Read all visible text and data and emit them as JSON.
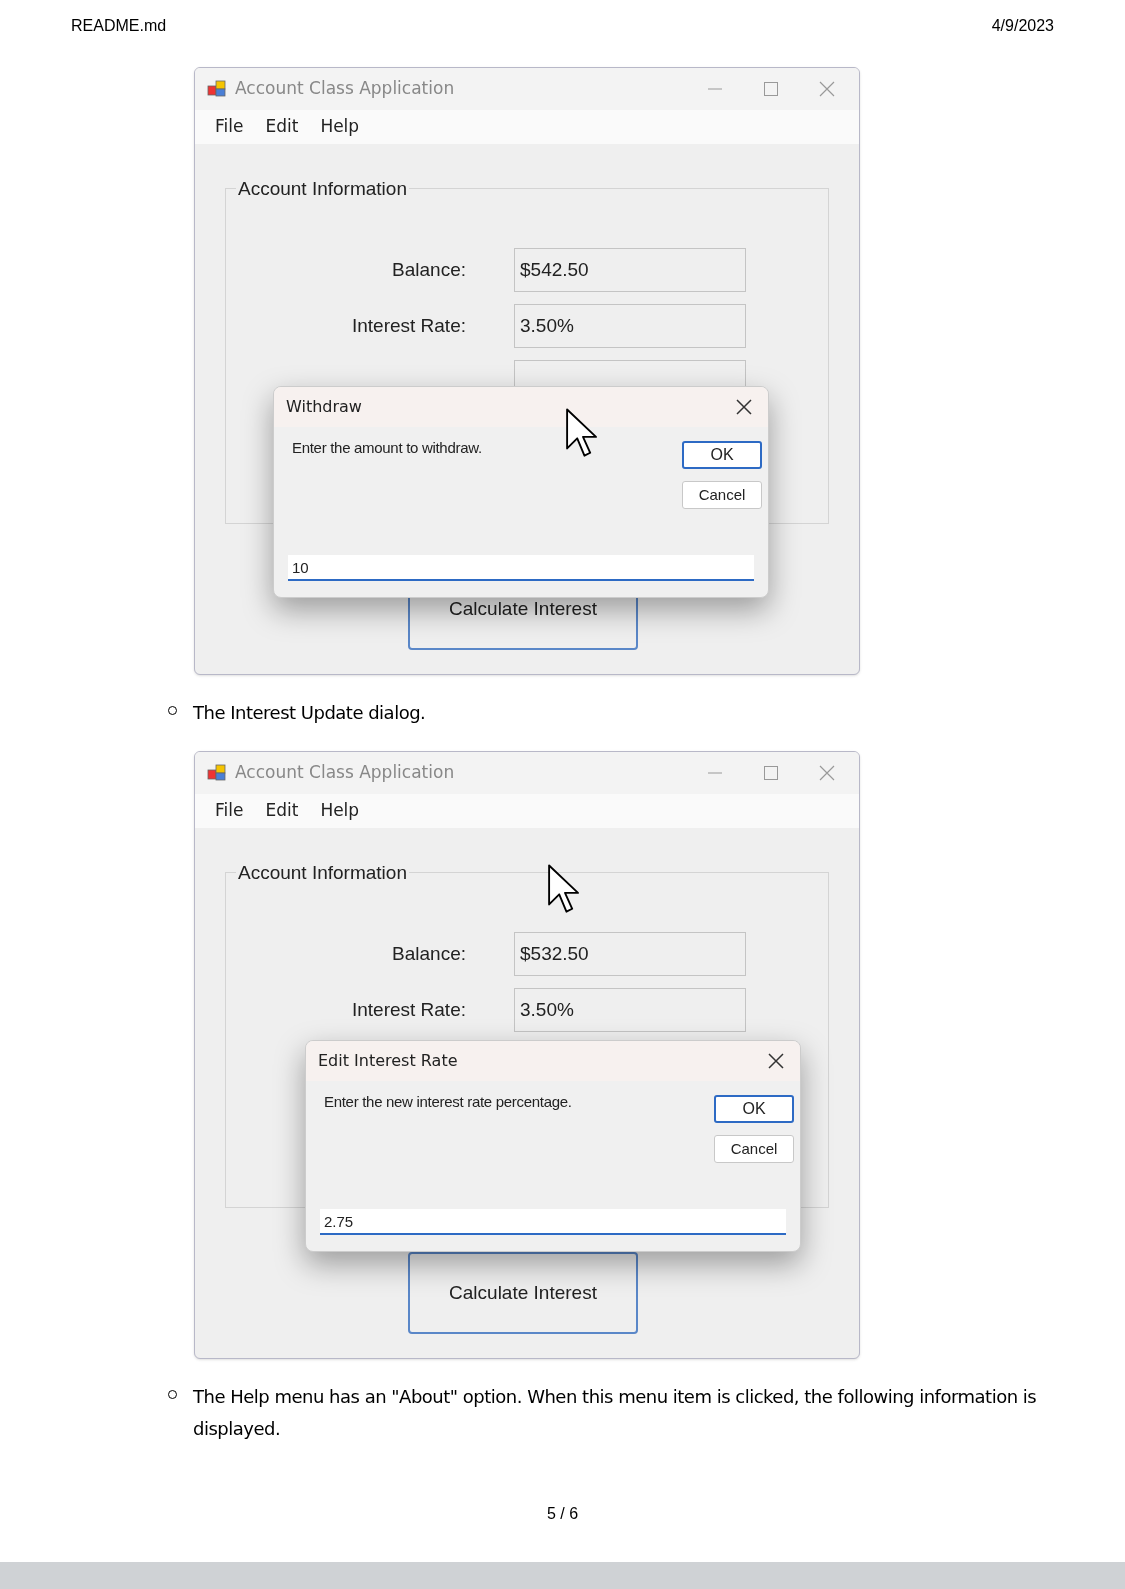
{
  "header": {
    "file_name": "README.md",
    "date": "4/9/2023"
  },
  "blocks": [
    {
      "kind": "window",
      "title": "Account Class Application",
      "menus": [
        "File",
        "Edit",
        "Help"
      ],
      "group_title": "Account Information",
      "fields": [
        {
          "label": "Balance:",
          "value": "$542.50"
        },
        {
          "label": "Interest Rate:",
          "value": "3.50%"
        }
      ],
      "button": "Calculate Interest",
      "dialog": {
        "title": "Withdraw",
        "prompt": "Enter the amount to withdraw.",
        "ok": "OK",
        "cancel": "Cancel",
        "value": "10"
      }
    },
    {
      "kind": "bullet",
      "text": "The Interest Update dialog."
    },
    {
      "kind": "window",
      "title": "Account Class Application",
      "menus": [
        "File",
        "Edit",
        "Help"
      ],
      "group_title": "Account Information",
      "fields": [
        {
          "label": "Balance:",
          "value": "$532.50"
        },
        {
          "label": "Interest Rate:",
          "value": "3.50%"
        }
      ],
      "button": "Calculate Interest",
      "dialog": {
        "title": "Edit Interest Rate",
        "prompt": "Enter the new interest rate percentage.",
        "ok": "OK",
        "cancel": "Cancel",
        "value": "2.75"
      }
    },
    {
      "kind": "bullet",
      "text": "The Help menu has an \"About\" option. When this menu item is clicked, the following information is displayed."
    }
  ],
  "page_number": "5 / 6"
}
